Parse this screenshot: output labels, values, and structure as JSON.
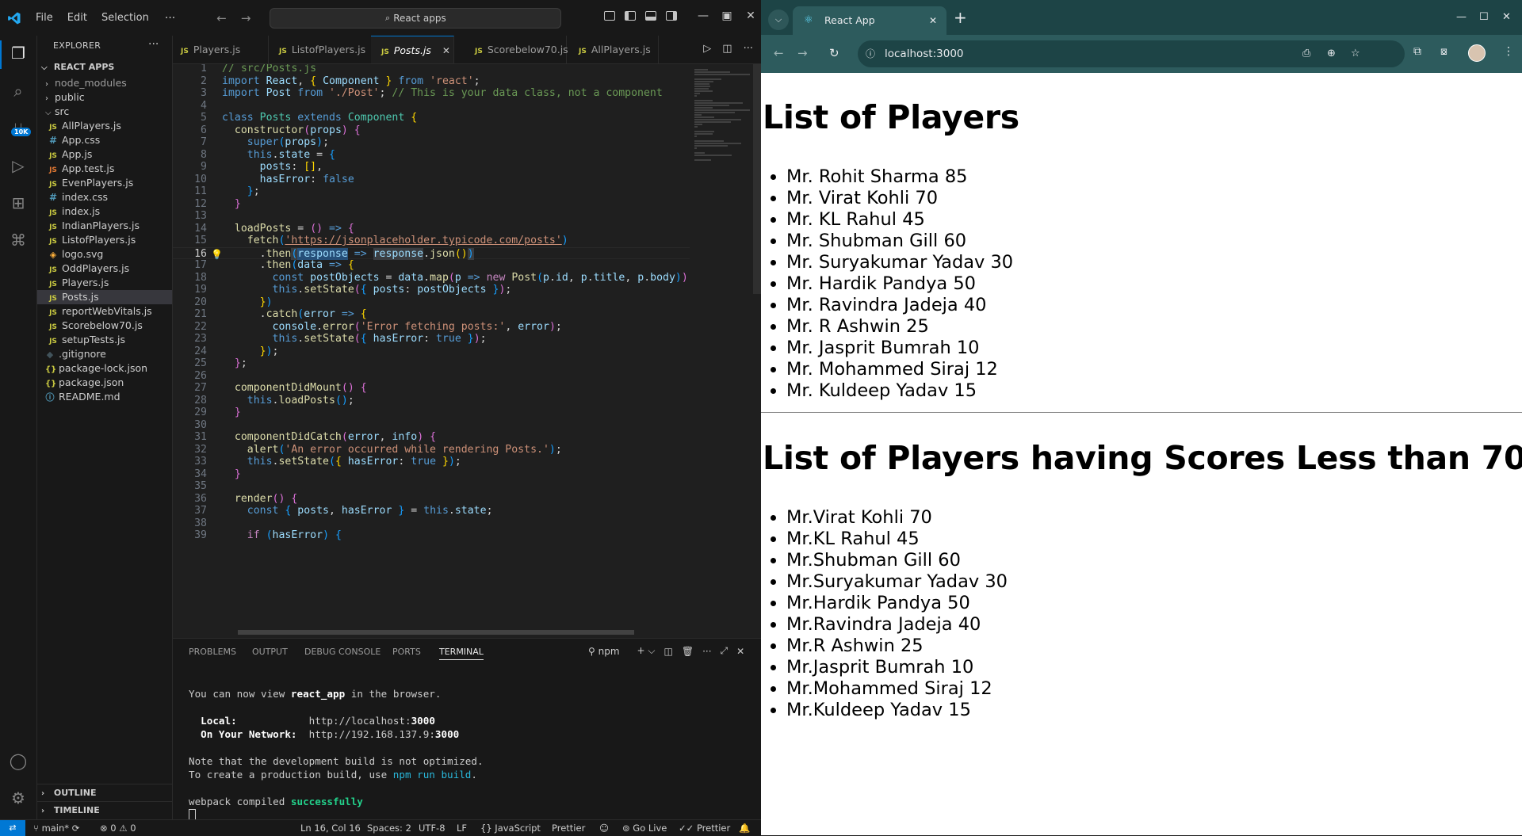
{
  "vscode": {
    "menu": [
      "File",
      "Edit",
      "Selection"
    ],
    "command_center": "React apps",
    "explorer": {
      "title": "EXPLORER",
      "root": "REACT APPS",
      "items": [
        {
          "label": "node_modules",
          "type": "folder",
          "depth": 1,
          "open": false
        },
        {
          "label": "public",
          "type": "folder",
          "depth": 1,
          "open": false
        },
        {
          "label": "src",
          "type": "folder",
          "depth": 1,
          "open": true
        },
        {
          "label": "AllPlayers.js",
          "type": "js",
          "depth": 2
        },
        {
          "label": "App.css",
          "type": "css",
          "depth": 2
        },
        {
          "label": "App.js",
          "type": "js",
          "depth": 2
        },
        {
          "label": "App.test.js",
          "type": "test",
          "depth": 2
        },
        {
          "label": "EvenPlayers.js",
          "type": "js",
          "depth": 2
        },
        {
          "label": "index.css",
          "type": "css",
          "depth": 2
        },
        {
          "label": "index.js",
          "type": "js",
          "depth": 2
        },
        {
          "label": "IndianPlayers.js",
          "type": "js",
          "depth": 2
        },
        {
          "label": "ListofPlayers.js",
          "type": "js",
          "depth": 2
        },
        {
          "label": "logo.svg",
          "type": "svg",
          "depth": 2
        },
        {
          "label": "OddPlayers.js",
          "type": "js",
          "depth": 2
        },
        {
          "label": "Players.js",
          "type": "js",
          "depth": 2
        },
        {
          "label": "Posts.js",
          "type": "js",
          "depth": 2,
          "selected": true
        },
        {
          "label": "reportWebVitals.js",
          "type": "js",
          "depth": 2
        },
        {
          "label": "Scorebelow70.js",
          "type": "js",
          "depth": 2
        },
        {
          "label": "setupTests.js",
          "type": "js",
          "depth": 2
        },
        {
          "label": ".gitignore",
          "type": "git",
          "depth": 1
        },
        {
          "label": "package-lock.json",
          "type": "json",
          "depth": 1
        },
        {
          "label": "package.json",
          "type": "json",
          "depth": 1
        },
        {
          "label": "README.md",
          "type": "md",
          "depth": 1
        }
      ],
      "outline": "OUTLINE",
      "timeline": "TIMELINE"
    },
    "source_control_badge": "10K",
    "tabs": [
      {
        "label": "Players.js",
        "active": false
      },
      {
        "label": "ListofPlayers.js",
        "active": false
      },
      {
        "label": "Posts.js",
        "active": true
      },
      {
        "label": "Scorebelow70.js",
        "active": false
      },
      {
        "label": "AllPlayers.js",
        "active": false
      }
    ],
    "current_line": 16,
    "code": [
      [
        [
          "c",
          "// src/Posts.js"
        ]
      ],
      [
        [
          "k",
          "import "
        ],
        [
          "v",
          "React"
        ],
        [
          "p",
          ", "
        ],
        [
          "b1",
          "{ "
        ],
        [
          "v",
          "Component"
        ],
        [
          "b1",
          " }"
        ],
        [
          "k",
          " from "
        ],
        [
          "s",
          "'react'"
        ],
        [
          "p",
          ";"
        ]
      ],
      [
        [
          "k",
          "import "
        ],
        [
          "v",
          "Post"
        ],
        [
          "k",
          " from "
        ],
        [
          "s",
          "'./Post'"
        ],
        [
          "p",
          "; "
        ],
        [
          "c",
          "// This is your data class, not a component"
        ]
      ],
      [],
      [
        [
          "k",
          "class "
        ],
        [
          "t",
          "Posts "
        ],
        [
          "k",
          "extends "
        ],
        [
          "t",
          "Component "
        ],
        [
          "b1",
          "{"
        ]
      ],
      [
        [
          "p",
          "  "
        ],
        [
          "f",
          "constructor"
        ],
        [
          "b2",
          "("
        ],
        [
          "v",
          "props"
        ],
        [
          "b2",
          ")"
        ],
        [
          "p",
          " "
        ],
        [
          "b2",
          "{"
        ]
      ],
      [
        [
          "p",
          "    "
        ],
        [
          "k",
          "super"
        ],
        [
          "b3",
          "("
        ],
        [
          "v",
          "props"
        ],
        [
          "b3",
          ")"
        ],
        [
          "p",
          ";"
        ]
      ],
      [
        [
          "p",
          "    "
        ],
        [
          "k",
          "this"
        ],
        [
          "p",
          "."
        ],
        [
          "v",
          "state"
        ],
        [
          "p",
          " = "
        ],
        [
          "b3",
          "{"
        ]
      ],
      [
        [
          "p",
          "      "
        ],
        [
          "v",
          "posts"
        ],
        [
          "p",
          ": "
        ],
        [
          "b1",
          "[]"
        ],
        [
          "p",
          ","
        ]
      ],
      [
        [
          "p",
          "      "
        ],
        [
          "v",
          "hasError"
        ],
        [
          "p",
          ": "
        ],
        [
          "k",
          "false"
        ]
      ],
      [
        [
          "p",
          "    "
        ],
        [
          "b3",
          "}"
        ],
        [
          "p",
          ";"
        ]
      ],
      [
        [
          "p",
          "  "
        ],
        [
          "b2",
          "}"
        ]
      ],
      [],
      [
        [
          "p",
          "  "
        ],
        [
          "f",
          "loadPosts"
        ],
        [
          "p",
          " = "
        ],
        [
          "b2",
          "()"
        ],
        [
          "k",
          " => "
        ],
        [
          "b2",
          "{"
        ]
      ],
      [
        [
          "p",
          "    "
        ],
        [
          "f",
          "fetch"
        ],
        [
          "b3",
          "("
        ],
        [
          "su",
          "'https://jsonplaceholder.typicode.com/posts'"
        ],
        [
          "b3",
          ")"
        ]
      ],
      [
        [
          "p",
          "      ."
        ],
        [
          "f",
          "then"
        ],
        [
          "hb",
          "("
        ],
        [
          "sel",
          "response"
        ],
        [
          "k",
          " => "
        ],
        [
          "hl",
          "response"
        ],
        [
          "p",
          "."
        ],
        [
          "f",
          "json"
        ],
        [
          "b1",
          "()"
        ],
        [
          "hb",
          ")"
        ]
      ],
      [
        [
          "p",
          "      ."
        ],
        [
          "f",
          "then"
        ],
        [
          "b3",
          "("
        ],
        [
          "v",
          "data"
        ],
        [
          "k",
          " => "
        ],
        [
          "b1",
          "{"
        ]
      ],
      [
        [
          "p",
          "        "
        ],
        [
          "k",
          "const "
        ],
        [
          "v",
          "postObjects"
        ],
        [
          "p",
          " = "
        ],
        [
          "v",
          "data"
        ],
        [
          "p",
          "."
        ],
        [
          "f",
          "map"
        ],
        [
          "b2",
          "("
        ],
        [
          "v",
          "p"
        ],
        [
          "k",
          " => "
        ],
        [
          "k2",
          "new "
        ],
        [
          "f",
          "Post"
        ],
        [
          "b3",
          "("
        ],
        [
          "v",
          "p"
        ],
        [
          "p",
          "."
        ],
        [
          "v",
          "id"
        ],
        [
          "p",
          ", "
        ],
        [
          "v",
          "p"
        ],
        [
          "p",
          "."
        ],
        [
          "v",
          "title"
        ],
        [
          "p",
          ", "
        ],
        [
          "v",
          "p"
        ],
        [
          "p",
          "."
        ],
        [
          "v",
          "body"
        ],
        [
          "b3",
          ")"
        ],
        [
          "b2",
          ")"
        ],
        [
          "p",
          ";"
        ]
      ],
      [
        [
          "p",
          "        "
        ],
        [
          "k",
          "this"
        ],
        [
          "p",
          "."
        ],
        [
          "f",
          "setState"
        ],
        [
          "b2",
          "("
        ],
        [
          "b3",
          "{ "
        ],
        [
          "v",
          "posts"
        ],
        [
          "p",
          ": "
        ],
        [
          "v",
          "postObjects"
        ],
        [
          "b3",
          " }"
        ],
        [
          "b2",
          ")"
        ],
        [
          "p",
          ";"
        ]
      ],
      [
        [
          "p",
          "      "
        ],
        [
          "b1",
          "}"
        ],
        [
          "b3",
          ")"
        ]
      ],
      [
        [
          "p",
          "      ."
        ],
        [
          "f",
          "catch"
        ],
        [
          "b3",
          "("
        ],
        [
          "v",
          "error"
        ],
        [
          "k",
          " => "
        ],
        [
          "b1",
          "{"
        ]
      ],
      [
        [
          "p",
          "        "
        ],
        [
          "v",
          "console"
        ],
        [
          "p",
          "."
        ],
        [
          "f",
          "error"
        ],
        [
          "b2",
          "("
        ],
        [
          "s",
          "'Error fetching posts:'"
        ],
        [
          "p",
          ", "
        ],
        [
          "v",
          "error"
        ],
        [
          "b2",
          ")"
        ],
        [
          "p",
          ";"
        ]
      ],
      [
        [
          "p",
          "        "
        ],
        [
          "k",
          "this"
        ],
        [
          "p",
          "."
        ],
        [
          "f",
          "setState"
        ],
        [
          "b2",
          "("
        ],
        [
          "b3",
          "{ "
        ],
        [
          "v",
          "hasError"
        ],
        [
          "p",
          ": "
        ],
        [
          "k",
          "true"
        ],
        [
          "b3",
          " }"
        ],
        [
          "b2",
          ")"
        ],
        [
          "p",
          ";"
        ]
      ],
      [
        [
          "p",
          "      "
        ],
        [
          "b1",
          "}"
        ],
        [
          "b3",
          ")"
        ],
        [
          "p",
          ";"
        ]
      ],
      [
        [
          "p",
          "  "
        ],
        [
          "b2",
          "}"
        ],
        [
          "p",
          ";"
        ]
      ],
      [],
      [
        [
          "p",
          "  "
        ],
        [
          "f",
          "componentDidMount"
        ],
        [
          "b2",
          "()"
        ],
        [
          "p",
          " "
        ],
        [
          "b2",
          "{"
        ]
      ],
      [
        [
          "p",
          "    "
        ],
        [
          "k",
          "this"
        ],
        [
          "p",
          "."
        ],
        [
          "f",
          "loadPosts"
        ],
        [
          "b3",
          "()"
        ],
        [
          "p",
          ";"
        ]
      ],
      [
        [
          "p",
          "  "
        ],
        [
          "b2",
          "}"
        ]
      ],
      [],
      [
        [
          "p",
          "  "
        ],
        [
          "f",
          "componentDidCatch"
        ],
        [
          "b2",
          "("
        ],
        [
          "v",
          "error"
        ],
        [
          "p",
          ", "
        ],
        [
          "v",
          "info"
        ],
        [
          "b2",
          ")"
        ],
        [
          "p",
          " "
        ],
        [
          "b2",
          "{"
        ]
      ],
      [
        [
          "p",
          "    "
        ],
        [
          "f",
          "alert"
        ],
        [
          "b3",
          "("
        ],
        [
          "s",
          "'An error occurred while rendering Posts.'"
        ],
        [
          "b3",
          ")"
        ],
        [
          "p",
          ";"
        ]
      ],
      [
        [
          "p",
          "    "
        ],
        [
          "k",
          "this"
        ],
        [
          "p",
          "."
        ],
        [
          "f",
          "setState"
        ],
        [
          "b3",
          "("
        ],
        [
          "b1",
          "{ "
        ],
        [
          "v",
          "hasError"
        ],
        [
          "p",
          ": "
        ],
        [
          "k",
          "true"
        ],
        [
          "b1",
          " }"
        ],
        [
          "b3",
          ")"
        ],
        [
          "p",
          ";"
        ]
      ],
      [
        [
          "p",
          "  "
        ],
        [
          "b2",
          "}"
        ]
      ],
      [],
      [
        [
          "p",
          "  "
        ],
        [
          "f",
          "render"
        ],
        [
          "b2",
          "()"
        ],
        [
          "p",
          " "
        ],
        [
          "b2",
          "{"
        ]
      ],
      [
        [
          "p",
          "    "
        ],
        [
          "k",
          "const "
        ],
        [
          "b3",
          "{ "
        ],
        [
          "v",
          "posts"
        ],
        [
          "p",
          ", "
        ],
        [
          "v",
          "hasError"
        ],
        [
          "b3",
          " }"
        ],
        [
          "p",
          " = "
        ],
        [
          "k",
          "this"
        ],
        [
          "p",
          "."
        ],
        [
          "v",
          "state"
        ],
        [
          "p",
          ";"
        ]
      ],
      [],
      [
        [
          "p",
          "    "
        ],
        [
          "k2",
          "if "
        ],
        [
          "b3",
          "("
        ],
        [
          "v",
          "hasError"
        ],
        [
          "b3",
          ")"
        ],
        [
          "p",
          " "
        ],
        [
          "b3",
          "{"
        ]
      ]
    ],
    "panel_tabs": [
      {
        "label": "PROBLEMS",
        "active": false
      },
      {
        "label": "OUTPUT",
        "active": false
      },
      {
        "label": "DEBUG CONSOLE",
        "active": false
      },
      {
        "label": "PORTS",
        "active": false
      },
      {
        "label": "TERMINAL",
        "active": true
      }
    ],
    "terminal_profile": "npm",
    "terminal": {
      "line1_pre": "You can now view ",
      "line1_app": "react_app",
      "line1_post": " in the browser.",
      "local_label": "Local:",
      "local_url_pre": "http://localhost:",
      "local_port": "3000",
      "network_label": "On Your Network:",
      "network_url_pre": "http://192.168.137.9:",
      "network_port": "3000",
      "note1": "Note that the development build is not optimized.",
      "note2_pre": "To create a production build, use ",
      "note2_cmd": "npm run build",
      "note2_post": ".",
      "compiled_pre": "webpack compiled ",
      "compiled_status": "successfully"
    },
    "status": {
      "branch": "main*",
      "problems": "0",
      "warnings": "0",
      "position": "Ln 16, Col 16",
      "spaces": "Spaces: 2",
      "encoding": "UTF-8",
      "eol": "LF",
      "language": "JavaScript",
      "prettier1": "Prettier",
      "golive": "Go Live",
      "prettier2": "Prettier"
    }
  },
  "chrome": {
    "tab_title": "React App",
    "url": "localhost:3000",
    "page": {
      "heading1": "List of Players",
      "list1": [
        "Mr. Rohit Sharma 85",
        "Mr. Virat Kohli 70",
        "Mr. KL Rahul 45",
        "Mr. Shubman Gill 60",
        "Mr. Suryakumar Yadav 30",
        "Mr. Hardik Pandya 50",
        "Mr. Ravindra Jadeja 40",
        "Mr. R Ashwin 25",
        "Mr. Jasprit Bumrah 10",
        "Mr. Mohammed Siraj 12",
        "Mr. Kuldeep Yadav 15"
      ],
      "heading2": "List of Players having Scores Less than 70",
      "list2": [
        "Mr.Virat Kohli 70",
        "Mr.KL Rahul 45",
        "Mr.Shubman Gill 60",
        "Mr.Suryakumar Yadav 30",
        "Mr.Hardik Pandya 50",
        "Mr.Ravindra Jadeja 40",
        "Mr.R Ashwin 25",
        "Mr.Jasprit Bumrah 10",
        "Mr.Mohammed Siraj 12",
        "Mr.Kuldeep Yadav 15"
      ]
    }
  }
}
